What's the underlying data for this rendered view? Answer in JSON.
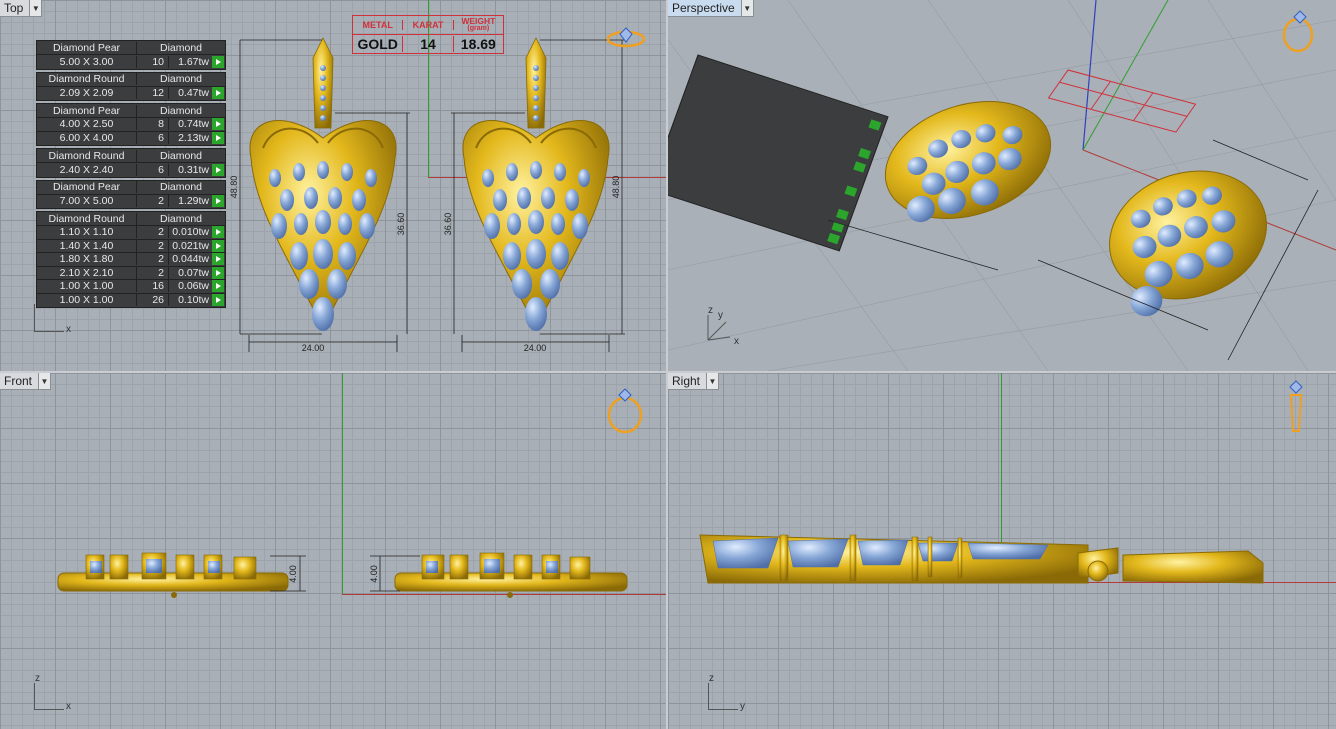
{
  "viewports": {
    "top": {
      "label": "Top"
    },
    "perspective": {
      "label": "Perspective"
    },
    "front": {
      "label": "Front"
    },
    "right": {
      "label": "Right"
    }
  },
  "metal_table": {
    "headers": [
      "METAL",
      "KARAT",
      "WEIGHT"
    ],
    "weight_unit": "(gram)",
    "values": [
      "GOLD",
      "14",
      "18.69"
    ]
  },
  "stone_table": [
    {
      "shape": "Diamond Pear",
      "type": "Diamond",
      "rows": [
        {
          "size": "5.00 X 3.00",
          "count": "10",
          "tw": "1.67tw"
        }
      ]
    },
    {
      "shape": "Diamond Round",
      "type": "Diamond",
      "rows": [
        {
          "size": "2.09 X 2.09",
          "count": "12",
          "tw": "0.47tw"
        }
      ]
    },
    {
      "shape": "Diamond Pear",
      "type": "Diamond",
      "rows": [
        {
          "size": "4.00 X 2.50",
          "count": "8",
          "tw": "0.74tw"
        },
        {
          "size": "6.00 X 4.00",
          "count": "6",
          "tw": "2.13tw"
        }
      ]
    },
    {
      "shape": "Diamond Round",
      "type": "Diamond",
      "rows": [
        {
          "size": "2.40 X 2.40",
          "count": "6",
          "tw": "0.31tw"
        }
      ]
    },
    {
      "shape": "Diamond Pear",
      "type": "Diamond",
      "rows": [
        {
          "size": "7.00 X 5.00",
          "count": "2",
          "tw": "1.29tw"
        }
      ]
    },
    {
      "shape": "Diamond Round",
      "type": "Diamond",
      "rows": [
        {
          "size": "1.10 X 1.10",
          "count": "2",
          "tw": "0.010tw"
        },
        {
          "size": "1.40 X 1.40",
          "count": "2",
          "tw": "0.021tw"
        },
        {
          "size": "1.80 X 1.80",
          "count": "2",
          "tw": "0.044tw"
        },
        {
          "size": "2.10 X 2.10",
          "count": "2",
          "tw": "0.07tw"
        },
        {
          "size": "1.00 X 1.00",
          "count": "16",
          "tw": "0.06tw"
        },
        {
          "size": "1.00 X 1.00",
          "count": "26",
          "tw": "0.10tw"
        }
      ]
    }
  ],
  "dimensions": {
    "width": "24.00",
    "height_total": "48.80",
    "height_body": "36.60",
    "thickness": "4.00"
  },
  "axis_labels": {
    "x": "x",
    "y": "y",
    "z": "z"
  },
  "colors": {
    "gold": "#e3b81c",
    "gold_dark": "#a8820c",
    "stone": "#7f9fcf",
    "accent_red": "#d0303a",
    "axis_green": "#2f9e2f",
    "axis_red": "#b23a3a",
    "ring_icon": "#f0a020"
  },
  "icons": [
    "ring-icon",
    "pendant-icon",
    "dropdown-arrow-icon",
    "go-arrow-icon"
  ]
}
